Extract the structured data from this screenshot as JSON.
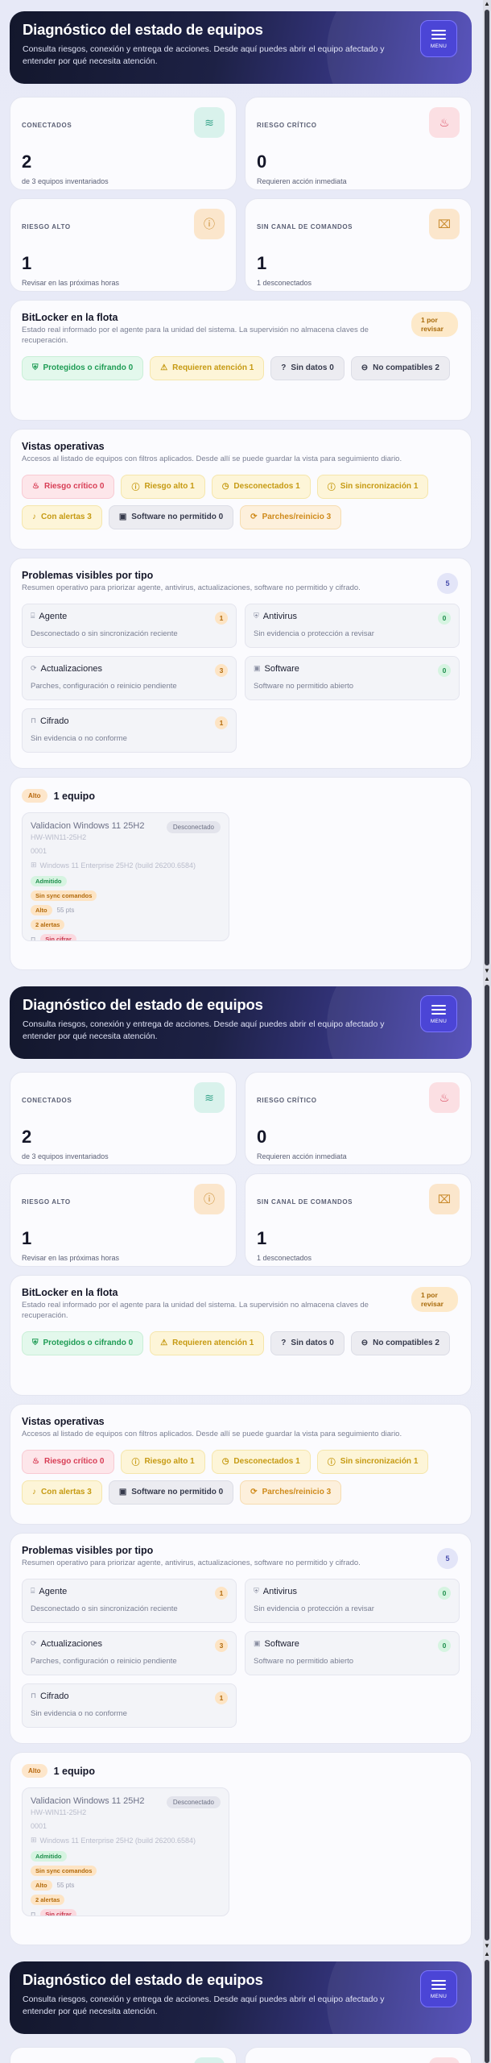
{
  "header": {
    "title": "Diagnóstico del estado de equipos",
    "description": "Consulta riesgos, conexión y entrega de acciones. Desde aquí puedes abrir el equipo afectado y entender por qué necesita atención.",
    "menu_label": "MENU"
  },
  "stats": [
    {
      "label": "CONECTADOS",
      "value": "2",
      "desc": "de 3 equipos inventariados",
      "icon": "wifi-icon",
      "icon_glyph": "📶",
      "icon_bg": "#d9f2ec",
      "icon_color": "#36a48a"
    },
    {
      "label": "RIESGO CRÍTICO",
      "value": "0",
      "desc": "Requieren acción inmediata",
      "icon": "flame-icon",
      "icon_glyph": "🔥",
      "icon_bg": "#fbdfe3",
      "icon_color": "#d8475d"
    },
    {
      "label": "RIESGO ALTO",
      "value": "1",
      "desc": "Revisar en las próximas horas",
      "icon": "alert-circle-icon",
      "icon_glyph": "ⓘ",
      "icon_bg": "#fbe6cc",
      "icon_color": "#c98a2c"
    },
    {
      "label": "SIN CANAL DE COMANDOS",
      "value": "1",
      "desc": "1 desconectados",
      "icon": "terminal-off-icon",
      "icon_glyph": "⌨",
      "icon_bg": "#fbe6cc",
      "icon_color": "#c98a2c"
    }
  ],
  "bitlocker": {
    "title": "BitLocker en la flota",
    "subtitle": "Estado real informado por el agente para la unidad del sistema. La supervisión no almacena claves de recuperación.",
    "badge": "1 por revisar",
    "chips": [
      {
        "label": "Protegidos o cifrando 0",
        "color": "green",
        "icon": "shield-check-icon",
        "glyph": "⛨"
      },
      {
        "label": "Requieren atención 1",
        "color": "yellow",
        "icon": "warning-icon",
        "glyph": "⚠"
      },
      {
        "label": "Sin datos 0",
        "color": "gray",
        "icon": "help-circle-icon",
        "glyph": "?"
      },
      {
        "label": "No compatibles 2",
        "color": "gray",
        "icon": "minus-circle-icon",
        "glyph": "⊖"
      }
    ]
  },
  "views": {
    "title": "Vistas operativas",
    "subtitle": "Accesos al listado de equipos con filtros aplicados. Desde allí se puede guardar la vista para seguimiento diario.",
    "chips": [
      {
        "label": "Riesgo crítico 0",
        "color": "red",
        "icon": "flame-icon",
        "glyph": "🔥"
      },
      {
        "label": "Riesgo alto 1",
        "color": "yellow",
        "icon": "alert-circle-icon",
        "glyph": "ⓘ"
      },
      {
        "label": "Desconectados 1",
        "color": "yellow",
        "icon": "clock-icon",
        "glyph": "◷"
      },
      {
        "label": "Sin sincronización 1",
        "color": "yellow",
        "icon": "alert-circle-icon",
        "glyph": "ⓘ"
      },
      {
        "label": "Con alertas 3",
        "color": "yellow",
        "icon": "bell-icon",
        "glyph": "🔔"
      },
      {
        "label": "Software no permitido 0",
        "color": "gray",
        "icon": "package-icon",
        "glyph": "▣"
      },
      {
        "label": "Parches/reinicio 3",
        "color": "orange",
        "icon": "refresh-icon",
        "glyph": "⟳"
      }
    ]
  },
  "problems": {
    "title": "Problemas visibles por tipo",
    "subtitle": "Resumen operativo para priorizar agente, antivirus, actualizaciones, software no permitido y cifrado.",
    "count": "5",
    "items": [
      {
        "label": "Agente",
        "desc": "Desconectado o sin sincronización reciente",
        "count": "1",
        "count_color": "orange",
        "icon": "agent-icon",
        "glyph": "⌸"
      },
      {
        "label": "Antivirus",
        "desc": "Sin evidencia o protección a revisar",
        "count": "0",
        "count_color": "green",
        "icon": "shield-icon",
        "glyph": "⛨"
      },
      {
        "label": "Actualizaciones",
        "desc": "Parches, configuración o reinicio pendiente",
        "count": "3",
        "count_color": "orange",
        "icon": "refresh-icon",
        "glyph": "⟳"
      },
      {
        "label": "Software",
        "desc": "Software no permitido abierto",
        "count": "0",
        "count_color": "green",
        "icon": "package-icon",
        "glyph": "▣"
      },
      {
        "label": "Cifrado",
        "desc": "Sin evidencia o no conforme",
        "count": "1",
        "count_color": "orange",
        "icon": "lock-icon",
        "glyph": "🔒"
      }
    ]
  },
  "group": {
    "severity": "Alto",
    "count_label": "1 equipo",
    "device": {
      "name": "Validacion Windows 11 25H2",
      "hostname": "HW-WIN11-25H2",
      "serial": "0001",
      "os": "Windows 11 Enterprise 25H2 (build 26200.6584)",
      "status": "Desconectado",
      "tags": [
        {
          "label": "Admitido",
          "color": "green"
        },
        {
          "label": "Sin sync comandos",
          "color": "orange"
        }
      ],
      "risk": {
        "label": "Alto",
        "points": "55 pts"
      },
      "alerts": "2 alertas",
      "extra_tag": "Sin cifrar"
    }
  }
}
